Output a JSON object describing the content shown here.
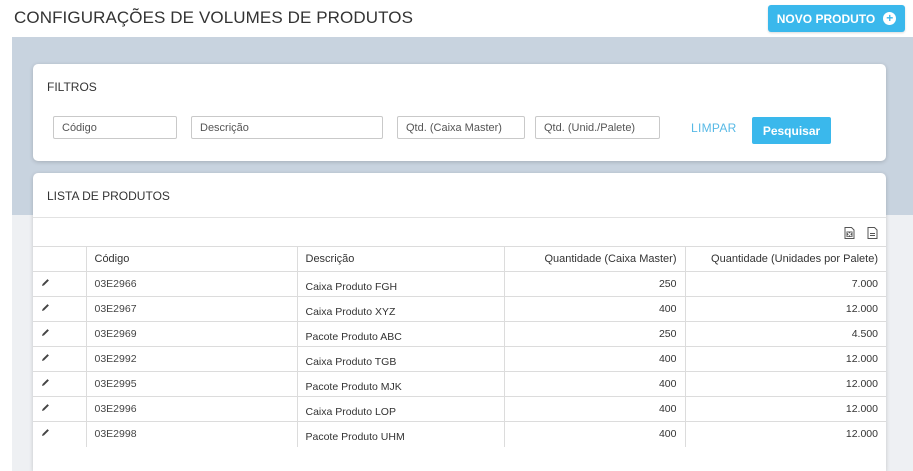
{
  "header": {
    "title": "CONFIGURAÇÕES DE VOLUMES DE PRODUTOS",
    "new_button_label": "NOVO PRODUTO",
    "new_button_icon": "plus-circle-icon"
  },
  "filters": {
    "title": "FILTROS",
    "codigo_placeholder": "Código",
    "descricao_placeholder": "Descrição",
    "caixa_master_placeholder": "Qtd. (Caixa Master)",
    "palete_placeholder": "Qtd. (Unid./Palete)",
    "clear_label": "LIMPAR",
    "search_label": "Pesquisar"
  },
  "list": {
    "title": "LISTA DE PRODUTOS",
    "export_icons": [
      "excel-export-icon",
      "pdf-export-icon"
    ],
    "columns": [
      "Código",
      "Descrição",
      "Quantidade (Caixa Master)",
      "Quantidade (Unidades por Palete)"
    ],
    "rows": [
      {
        "codigo": "03E2966",
        "descricao": "Caixa Produto FGH",
        "caixa_master": "250",
        "palete": "7.000"
      },
      {
        "codigo": "03E2967",
        "descricao": "Caixa Produto XYZ",
        "caixa_master": "400",
        "palete": "12.000"
      },
      {
        "codigo": "03E2969",
        "descricao": "Pacote Produto ABC",
        "caixa_master": "250",
        "palete": "4.500"
      },
      {
        "codigo": "03E2992",
        "descricao": "Caixa Produto TGB",
        "caixa_master": "400",
        "palete": "12.000"
      },
      {
        "codigo": "03E2995",
        "descricao": "Pacote Produto MJK",
        "caixa_master": "400",
        "palete": "12.000"
      },
      {
        "codigo": "03E2996",
        "descricao": "Caixa Produto LOP",
        "caixa_master": "400",
        "palete": "12.000"
      },
      {
        "codigo": "03E2998",
        "descricao": "Pacote Produto UHM",
        "caixa_master": "400",
        "palete": "12.000"
      }
    ]
  },
  "colors": {
    "accent": "#3ab8ec",
    "band": "#c8d3df"
  }
}
